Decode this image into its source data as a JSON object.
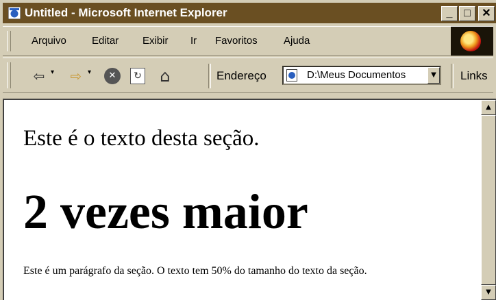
{
  "window": {
    "title": "Untitled - Microsoft Internet Explorer",
    "controls": {
      "minimize": "_",
      "maximize": "□",
      "close": "✕"
    }
  },
  "menu": {
    "items": [
      {
        "label": "Arquivo"
      },
      {
        "label": "Editar"
      },
      {
        "label": "Exibir"
      },
      {
        "label": "Ir"
      },
      {
        "label": "Favoritos"
      },
      {
        "label": "Ajuda"
      }
    ]
  },
  "toolbar": {
    "back_icon": "⇦",
    "forward_icon": "⇨",
    "stop_icon": "✕",
    "refresh_icon": "↻",
    "home_icon": "⌂",
    "dropdown_glyph": "▾",
    "address_label": "Endereço",
    "address_value": "D:\\Meus Documentos",
    "address_dropdown": "▼",
    "links_label": "Links"
  },
  "page": {
    "section_text": "Este é o texto desta seção.",
    "big_heading": "2 vezes maior",
    "paragraph": "Este é um parágrafo da seção. O texto tem 50% do tamanho do texto da seção."
  },
  "scrollbar": {
    "up": "▲",
    "down": "▼"
  },
  "colors": {
    "titlebar": "#6a4f22",
    "chrome": "#d4cdb6"
  }
}
